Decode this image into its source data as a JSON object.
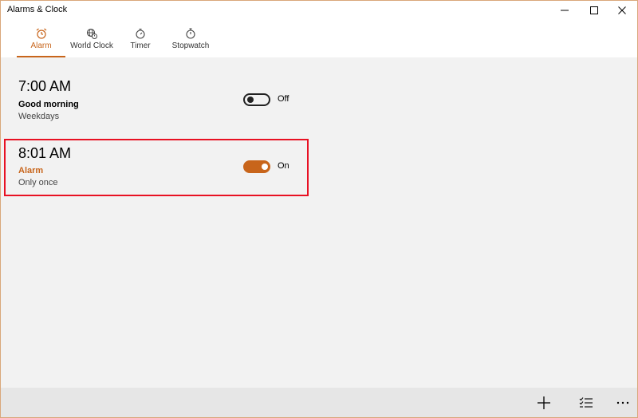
{
  "window": {
    "title": "Alarms & Clock"
  },
  "tabs": [
    {
      "label": "Alarm",
      "icon": "alarm-clock-icon",
      "active": true
    },
    {
      "label": "World Clock",
      "icon": "world-clock-icon",
      "active": false
    },
    {
      "label": "Timer",
      "icon": "timer-icon",
      "active": false
    },
    {
      "label": "Stopwatch",
      "icon": "stopwatch-icon",
      "active": false
    }
  ],
  "alarms": [
    {
      "time": "7:00 AM",
      "name": "Good morning",
      "repeat": "Weekdays",
      "state_label": "Off",
      "enabled": false
    },
    {
      "time": "8:01 AM",
      "name": "Alarm",
      "repeat": "Only once",
      "state_label": "On",
      "enabled": true
    }
  ],
  "commands": {
    "add": "add-icon",
    "select": "select-items-icon",
    "more": "more-icon"
  },
  "colors": {
    "accent": "#c8651b",
    "highlight_border": "#e81123",
    "background": "#f2f2f2"
  }
}
